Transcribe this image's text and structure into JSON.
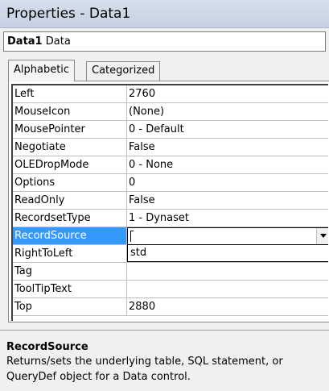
{
  "window": {
    "title": "Properties - Data1"
  },
  "object_selector": {
    "name": "Data1",
    "type": "Data"
  },
  "tabs": [
    {
      "label": "Alphabetic",
      "active": true
    },
    {
      "label": "Categorized",
      "active": false
    }
  ],
  "properties": [
    {
      "name": "Left",
      "value": "2760"
    },
    {
      "name": "MouseIcon",
      "value": "(None)"
    },
    {
      "name": "MousePointer",
      "value": "0 - Default"
    },
    {
      "name": "Negotiate",
      "value": "False"
    },
    {
      "name": "OLEDropMode",
      "value": "0 - None"
    },
    {
      "name": "Options",
      "value": "0"
    },
    {
      "name": "ReadOnly",
      "value": "False"
    },
    {
      "name": "RecordsetType",
      "value": "1 - Dynaset"
    },
    {
      "name": "RecordSource",
      "value": ""
    },
    {
      "name": "RightToLeft",
      "value": ""
    },
    {
      "name": "Tag",
      "value": ""
    },
    {
      "name": "ToolTipText",
      "value": ""
    },
    {
      "name": "Top",
      "value": "2880"
    }
  ],
  "selected_property": "RecordSource",
  "dropdown": {
    "items": [
      "std"
    ]
  },
  "description": {
    "title": "RecordSource",
    "text": "Returns/sets the underlying table, SQL statement, or QueryDef object for a Data control."
  },
  "colors": {
    "selection": "#3399ff",
    "titlebar": "#c9d4e4"
  }
}
